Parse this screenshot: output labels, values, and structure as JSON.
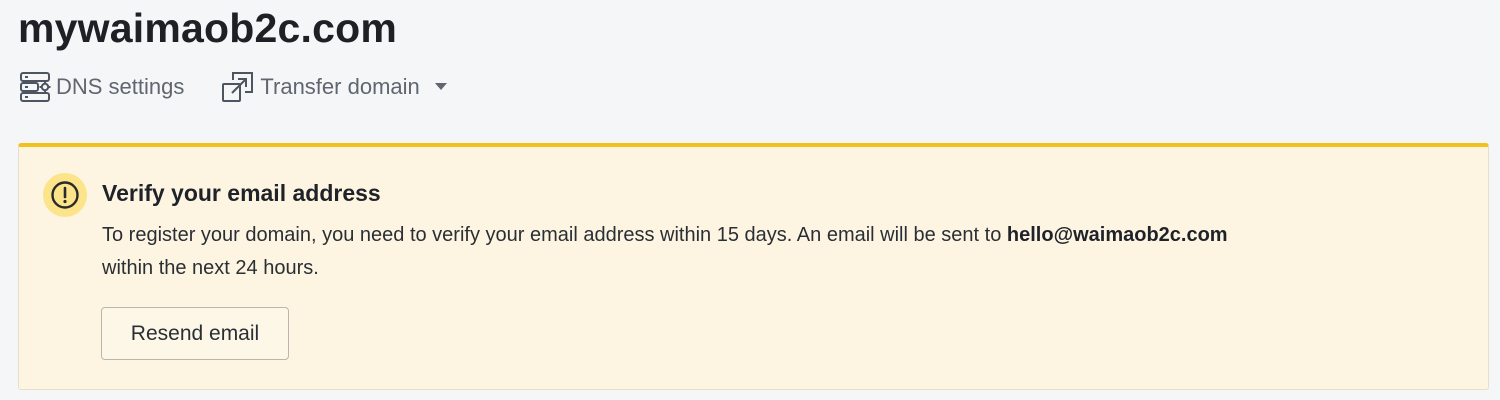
{
  "domain": {
    "name": "mywaimaob2c.com"
  },
  "actions": {
    "dns_settings": {
      "label": "DNS settings",
      "icon": "dns-settings-icon"
    },
    "transfer_domain": {
      "label": "Transfer domain",
      "icon": "transfer-icon",
      "dropdown_icon": "caret-down-icon"
    }
  },
  "alert": {
    "icon": "warning-icon",
    "title": "Verify your email address",
    "body_prefix": "To register your domain, you need to verify your email address within 15 days. An email will be sent to ",
    "email": "hello@waimaob2c.com",
    "body_suffix": " within the next 24 hours.",
    "resend_label": "Resend email",
    "accent_color": "#f2c11c",
    "background_color": "#fdf5e1"
  }
}
